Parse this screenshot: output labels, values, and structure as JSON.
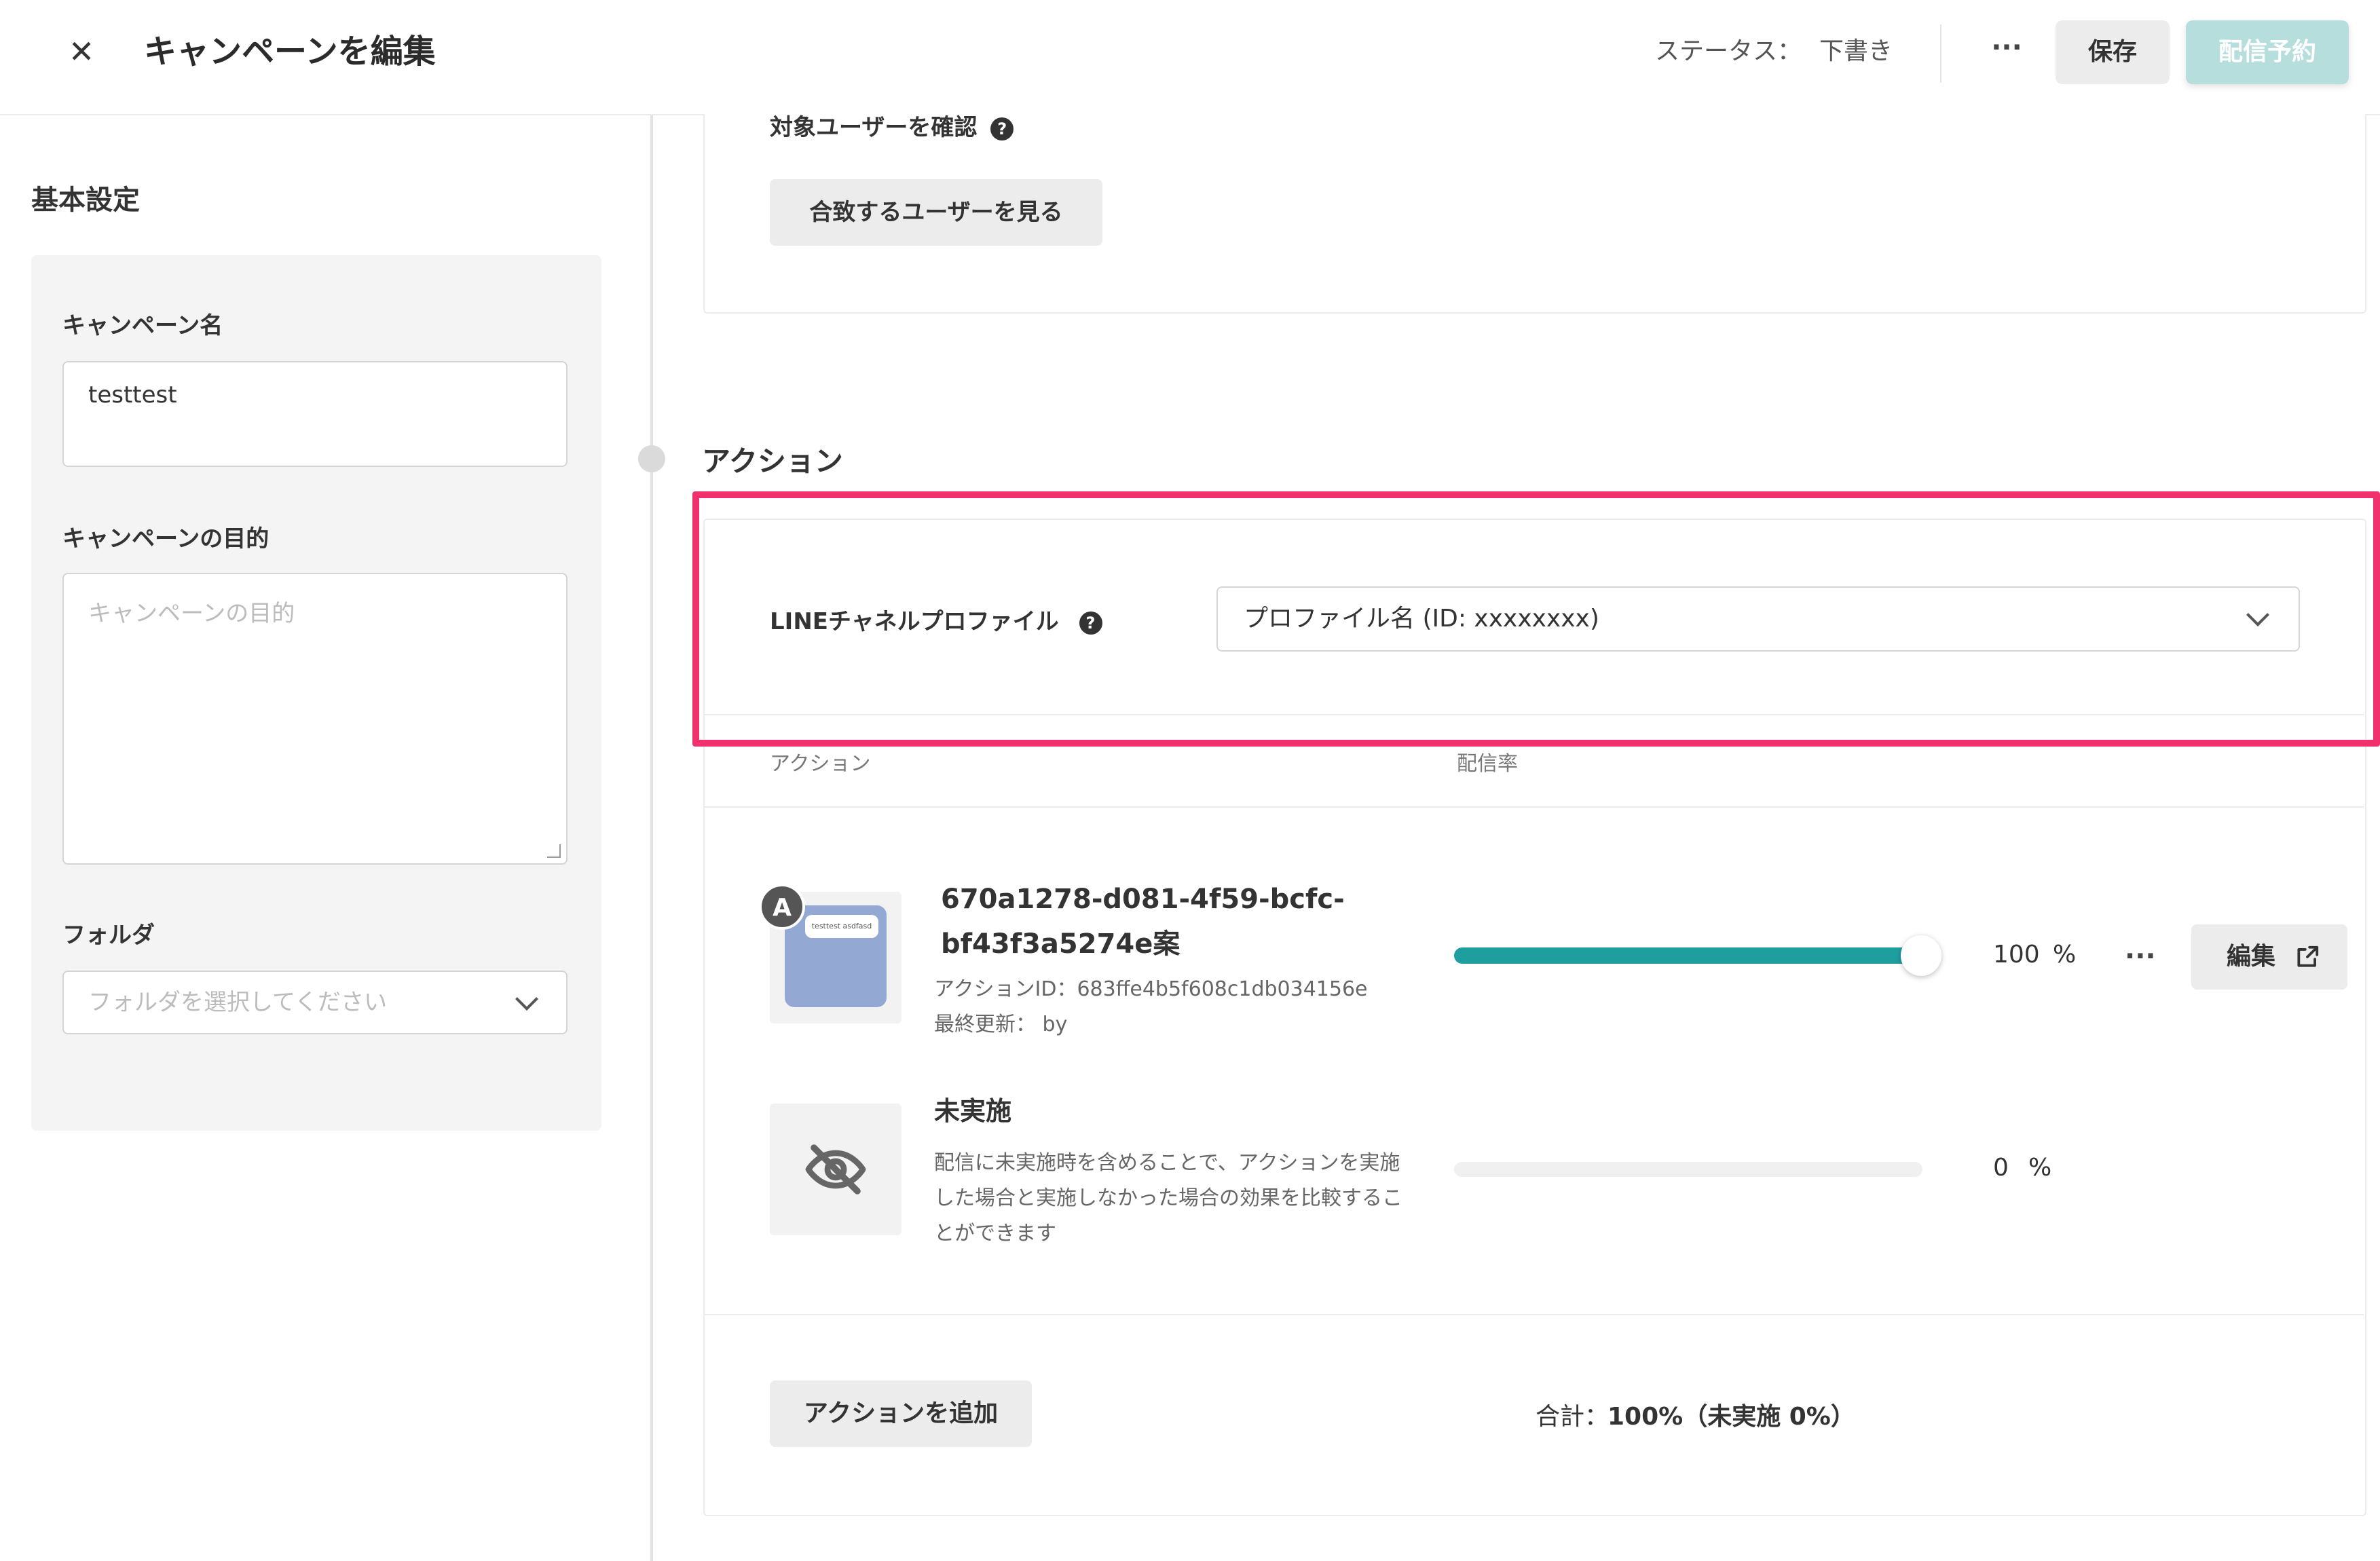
{
  "header": {
    "close_glyph": "✕",
    "title": "キャンペーンを編集",
    "status_label": "ステータス：",
    "status_value": "下書き",
    "more_glyph": "···",
    "save_label": "保存",
    "schedule_label": "配信予約"
  },
  "sidebar": {
    "heading": "基本設定",
    "campaign_name_label": "キャンペーン名",
    "campaign_name_value": "testtest",
    "purpose_label": "キャンペーンの目的",
    "purpose_placeholder": "キャンペーンの目的",
    "folder_label": "フォルダ",
    "folder_placeholder": "フォルダを選択してください"
  },
  "target": {
    "heading": "対象ユーザーを確認",
    "matching_users_button": "合致するユーザーを見る"
  },
  "action": {
    "section_title": "アクション",
    "line_profile_label": "LINEチャネルプロファイル",
    "profile_select_value": "プロファイル名 (ID: xxxxxxxx)",
    "col_action": "アクション",
    "col_rate": "配信率",
    "variants": [
      {
        "badge": "A",
        "thumb_text": "testtest asdfasd",
        "title": "670a1278-d081-4f59-bcfc-bf43f3a5274e案",
        "action_id": "アクションID：683ffe4b5f608c1db034156e",
        "last_updated": "最終更新： by",
        "rate": 100,
        "rate_text": "100",
        "percent_sign": "%",
        "edit_label": "編集"
      }
    ],
    "no_action": {
      "title": "未実施",
      "description": "配信に未実施時を含めることで、アクションを実施した場合と実施しなかった場合の効果を比較することができます",
      "rate": 0,
      "rate_text": "0",
      "percent_sign": "%"
    },
    "add_action_button": "アクションを追加",
    "total_label": "合計：",
    "total_value": "100%（未実施 0%）"
  },
  "colors": {
    "accent": "#1f9ea0",
    "highlight": "#f0316e",
    "schedule_button": "#b6dedd"
  },
  "icons": [
    "close-icon",
    "help-icon",
    "chevron-down-icon",
    "more-icon",
    "external-link-icon",
    "eye-off-icon"
  ]
}
